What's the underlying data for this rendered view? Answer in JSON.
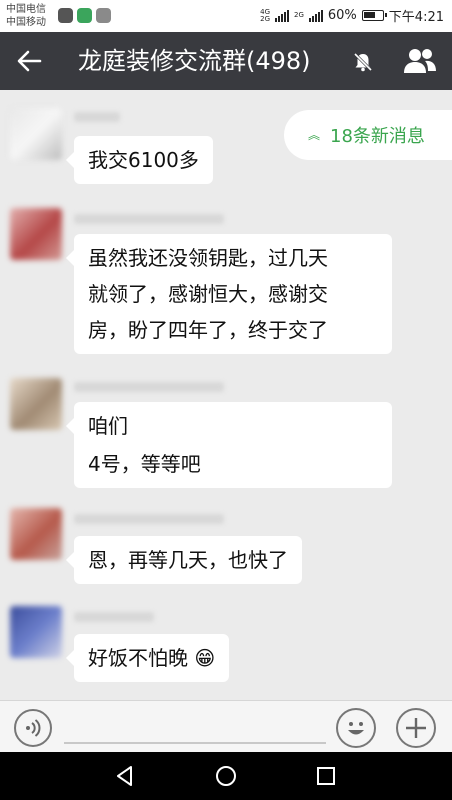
{
  "status_bar": {
    "carrier_1": "中国电信",
    "carrier_2": "中国移动",
    "net_1a": "4G",
    "net_1b": "2G",
    "net_2": "2G",
    "battery": "60%",
    "time": "下午4:21"
  },
  "header": {
    "title": "龙庭装修交流群(498)",
    "back_icon": "arrow-left-icon",
    "mute_icon": "bell-off-icon",
    "members_icon": "people-icon"
  },
  "new_messages_badge": "18条新消息",
  "messages": [
    {
      "text": "我交6100多"
    },
    {
      "lines": [
        "虽然我还没领钥匙，过几天",
        "就领了，感谢恒大，感谢交",
        "房，盼了四年了，终于交了"
      ]
    },
    {
      "line1_tail": "咱们",
      "line2": "4号，等等吧"
    },
    {
      "text": "恩，再等几天，也快了"
    },
    {
      "text": "好饭不怕晚",
      "emoji": "😁"
    }
  ],
  "colors": {
    "title_bar": "#393a3f",
    "chat_background": "#ebebeb",
    "new_messages_text": "#3aa54e",
    "bubble": "#ffffff"
  }
}
